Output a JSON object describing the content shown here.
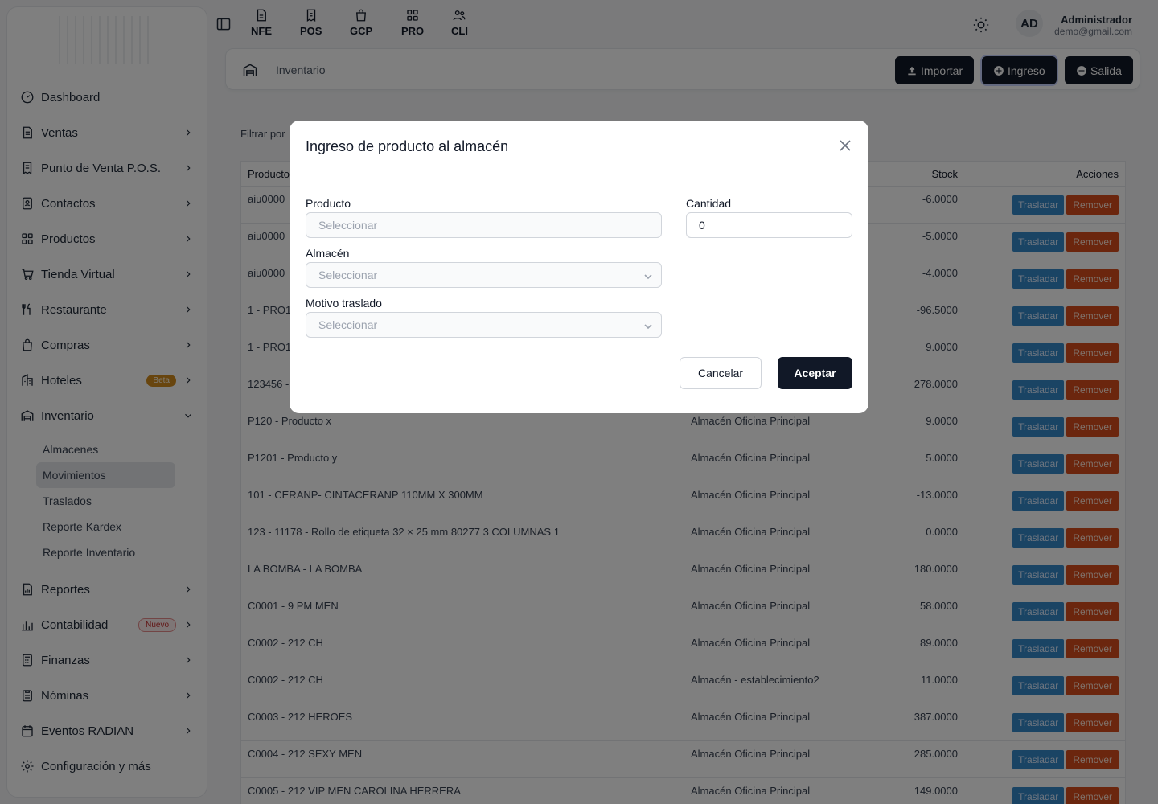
{
  "sidebar": {
    "items": [
      {
        "label": "Dashboard",
        "icon": "gauge-icon",
        "chevron": false
      },
      {
        "label": "Ventas",
        "icon": "document-icon",
        "chevron": true
      },
      {
        "label": "Punto de Venta P.O.S.",
        "icon": "receipt-icon",
        "chevron": true
      },
      {
        "label": "Contactos",
        "icon": "contacts-icon",
        "chevron": true
      },
      {
        "label": "Productos",
        "icon": "grid-icon",
        "chevron": true
      },
      {
        "label": "Tienda Virtual",
        "icon": "cart-icon",
        "chevron": true
      },
      {
        "label": "Restaurante",
        "icon": "utensils-icon",
        "chevron": true
      },
      {
        "label": "Compras",
        "icon": "bag-icon",
        "chevron": true
      },
      {
        "label": "Hoteles",
        "icon": "building-icon",
        "chevron": true,
        "badge": "Beta"
      },
      {
        "label": "Inventario",
        "icon": "warehouse-icon",
        "chevron": true,
        "expanded": true
      }
    ],
    "inventario_sub": [
      "Almacenes",
      "Movimientos",
      "Traslados",
      "Reporte Kardex",
      "Reporte Inventario"
    ],
    "active_sub": "Movimientos",
    "items_after": [
      {
        "label": "Reportes",
        "icon": "report-icon"
      },
      {
        "label": "Contabilidad",
        "icon": "chart-icon",
        "badge": "Nuevo"
      },
      {
        "label": "Finanzas",
        "icon": "calculator-icon"
      },
      {
        "label": "Nóminas",
        "icon": "clipboard-icon"
      },
      {
        "label": "Eventos RADIAN",
        "icon": "calendar-icon"
      },
      {
        "label": "Configuración y más",
        "icon": "gear-icon"
      }
    ]
  },
  "topbar": {
    "quick": [
      "NFE",
      "POS",
      "GCP",
      "PRO",
      "CLI"
    ],
    "avatar": "AD",
    "user_name": "Administrador",
    "user_email": "demo@gmail.com"
  },
  "header": {
    "breadcrumb": "Inventario",
    "btn_importar": "Importar",
    "btn_ingreso": "Ingreso",
    "btn_salida": "Salida"
  },
  "content": {
    "filter_label": "Filtrar por",
    "columns": {
      "producto": "Producto",
      "stock": "Stock",
      "acciones": "Acciones"
    },
    "btn_trasladar": "Trasladar",
    "btn_remover": "Remover",
    "rows": [
      {
        "producto": "aiu0000",
        "almacen": "",
        "stock": "-6.0000"
      },
      {
        "producto": "aiu0000",
        "almacen": "",
        "stock": "-5.0000"
      },
      {
        "producto": "aiu0000",
        "almacen": "",
        "stock": "-4.0000"
      },
      {
        "producto": "1 - PRO1",
        "almacen": "",
        "stock": "-96.5000"
      },
      {
        "producto": "1 - PRO1",
        "almacen": "",
        "stock": "9.0000"
      },
      {
        "producto": "123456 -",
        "almacen": "",
        "stock": "278.0000"
      },
      {
        "producto": "P120 - Producto x",
        "almacen": "Almacén Oficina Principal",
        "stock": "9.0000"
      },
      {
        "producto": "P1201 - Producto y",
        "almacen": "Almacén Oficina Principal",
        "stock": "5.0000"
      },
      {
        "producto": "101 - CERANP- CINTACERANP 110MM X 300MM",
        "almacen": "Almacén Oficina Principal",
        "stock": "-13.0000"
      },
      {
        "producto": "123 - 11178 - Rollo de etiqueta 32 × 25 mm 80277 3 COLUMNAS 1",
        "almacen": "Almacén Oficina Principal",
        "stock": "0.0000"
      },
      {
        "producto": "LA BOMBA - LA BOMBA",
        "almacen": "Almacén Oficina Principal",
        "stock": "180.0000"
      },
      {
        "producto": "C0001 - 9 PM MEN",
        "almacen": "Almacén Oficina Principal",
        "stock": "58.0000"
      },
      {
        "producto": "C0002 - 212 CH",
        "almacen": "Almacén Oficina Principal",
        "stock": "89.0000"
      },
      {
        "producto": "C0002 - 212 CH",
        "almacen": "Almacén - establecimiento2",
        "stock": "11.0000"
      },
      {
        "producto": "C0003 - 212 HEROES",
        "almacen": "Almacén Oficina Principal",
        "stock": "387.0000"
      },
      {
        "producto": "C0004 - 212 SEXY MEN",
        "almacen": "Almacén Oficina Principal",
        "stock": "285.0000"
      },
      {
        "producto": "C0005 - 212 VIP MEN CAROLINA HERRERA",
        "almacen": "Almacén Oficina Principal",
        "stock": "149.0000"
      }
    ]
  },
  "modal": {
    "title": "Ingreso de producto al almacén",
    "producto_label": "Producto",
    "producto_placeholder": "Seleccionar",
    "cantidad_label": "Cantidad",
    "cantidad_value": "0",
    "almacen_label": "Almacén",
    "almacen_placeholder": "Seleccionar",
    "motivo_label": "Motivo traslado",
    "motivo_placeholder": "Seleccionar",
    "cancel": "Cancelar",
    "accept": "Aceptar"
  },
  "colors": {
    "primary": "#111827",
    "trasladar": "#3489c9",
    "remover": "#d64d1c",
    "beta": "#d08b1c"
  }
}
